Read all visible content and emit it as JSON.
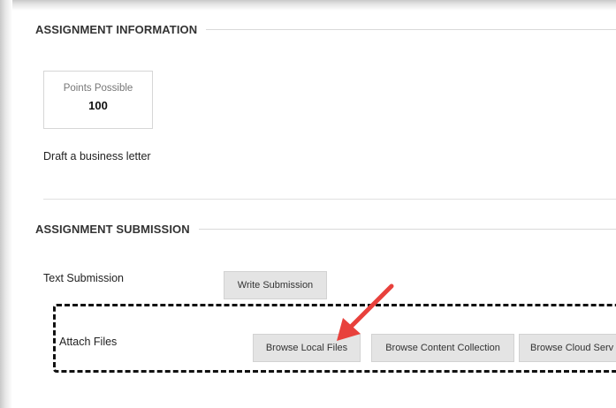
{
  "assignment_information": {
    "heading": "ASSIGNMENT INFORMATION",
    "points_label": "Points Possible",
    "points_value": "100",
    "description": "Draft a business letter"
  },
  "assignment_submission": {
    "heading": "ASSIGNMENT SUBMISSION",
    "text_submission_label": "Text Submission",
    "write_submission_button": "Write Submission",
    "attach_files_label": "Attach Files",
    "browse_local_files_button": "Browse Local Files",
    "browse_content_collection_button": "Browse Content Collection",
    "browse_cloud_storage_button": "Browse Cloud Serv"
  },
  "annotation": {
    "arrow_color": "#e8413c",
    "highlight_style": "dashed-border"
  },
  "colors": {
    "button_bg": "#e4e4e4",
    "heading_text": "#333333",
    "rule": "#d9d9d9"
  }
}
